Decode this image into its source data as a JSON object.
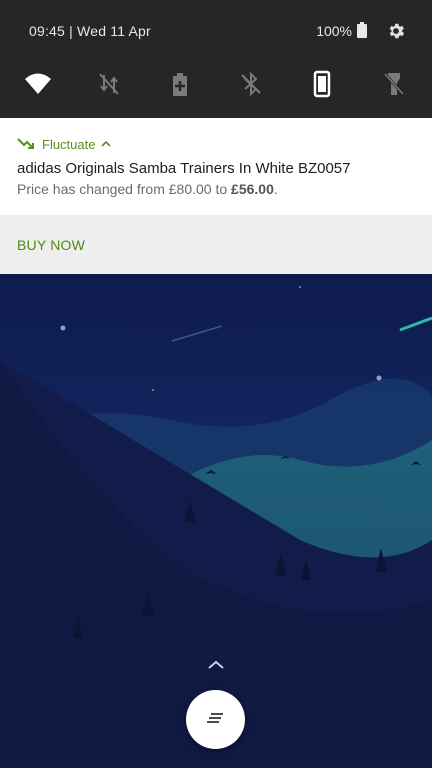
{
  "status_bar": {
    "time_date": "09:45 | Wed 11 Apr",
    "battery": "100%",
    "icons": [
      "battery-icon",
      "gear-icon"
    ]
  },
  "quick_settings": {
    "tiles": [
      "wifi-icon",
      "mobile-data-off-icon",
      "battery-saver-icon",
      "bluetooth-off-icon",
      "auto-rotate-icon",
      "flashlight-off-icon"
    ]
  },
  "notification": {
    "app_name": "Fluctuate",
    "title": "adidas Originals Samba Trainers In White BZ0057",
    "body_prefix": "Price has changed from £80.00 to ",
    "body_new_price": "£56.00",
    "body_suffix": ".",
    "action_label": "BUY NOW"
  },
  "colors": {
    "accent": "#5a8f1c",
    "shade": "#262626",
    "wallpaper_sky": "#10205a",
    "wallpaper_mountain": "#0f1a44",
    "wallpaper_teal": "#1d5d71"
  },
  "home": {
    "icons": [
      "chevron-up-icon",
      "notes-icon"
    ]
  }
}
